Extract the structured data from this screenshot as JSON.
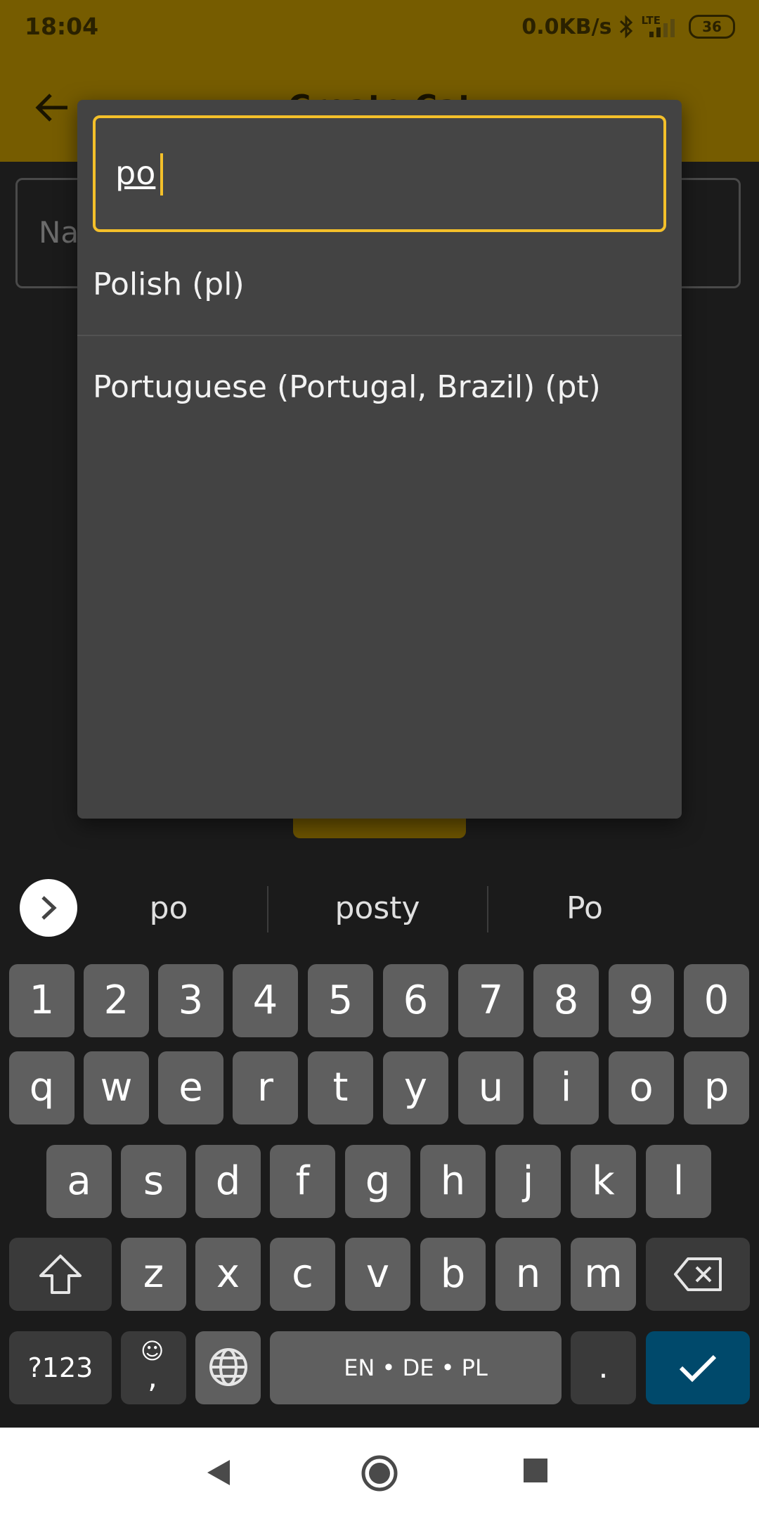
{
  "status": {
    "time": "18:04",
    "speed": "0.0KB/s",
    "network": "LTE",
    "battery": "36"
  },
  "appbar": {
    "title": "Create Cat"
  },
  "form": {
    "name_label": "Na"
  },
  "dialog": {
    "search_value": "po",
    "options": [
      "Polish (pl)",
      "Portuguese (Portugal, Brazil) (pt)"
    ]
  },
  "suggestions": [
    "po",
    "posty",
    "Po"
  ],
  "keyboard": {
    "row1": [
      "1",
      "2",
      "3",
      "4",
      "5",
      "6",
      "7",
      "8",
      "9",
      "0"
    ],
    "row2": [
      "q",
      "w",
      "e",
      "r",
      "t",
      "y",
      "u",
      "i",
      "o",
      "p"
    ],
    "row3": [
      "a",
      "s",
      "d",
      "f",
      "g",
      "h",
      "j",
      "k",
      "l"
    ],
    "row4": [
      "z",
      "x",
      "c",
      "v",
      "b",
      "n",
      "m"
    ],
    "symbols_label": "?123",
    "comma_label": ",",
    "space_label": "EN • DE • PL",
    "period_label": "."
  },
  "colors": {
    "accent": "#f4c02a",
    "appbar": "#765c00",
    "dialog": "#434343",
    "enter_key": "#00496b"
  }
}
